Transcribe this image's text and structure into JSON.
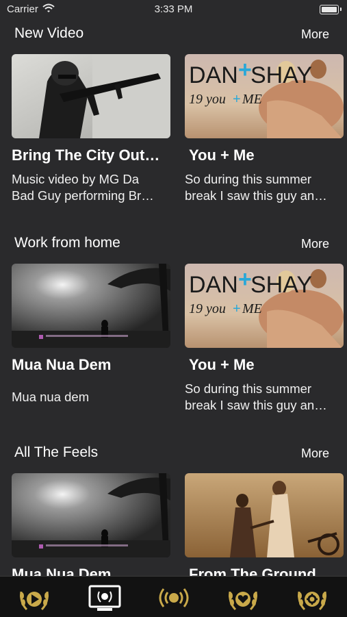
{
  "status_bar": {
    "carrier": "Carrier",
    "time": "3:33 PM"
  },
  "sections": [
    {
      "title": "New Video",
      "more": "More",
      "cards": [
        {
          "title": "Bring The City Out…",
          "desc_lines": [
            "Music video by MG Da",
            "Bad Guy performing Br…"
          ]
        },
        {
          "title": "You + Me",
          "desc_lines": [
            "So during this summer",
            "break I saw this guy an…"
          ],
          "thumb_text": {
            "brand_a": "DAN",
            "brand_b": "SHAY",
            "sub_a": "19 you",
            "sub_b": "ME"
          }
        }
      ]
    },
    {
      "title": "Work from home",
      "more": "More",
      "cards": [
        {
          "title": "Mua Nua Dem",
          "desc_lines": [
            "Mua nua dem"
          ]
        },
        {
          "title": "You + Me",
          "desc_lines": [
            "So during this summer",
            "break I saw this guy an…"
          ],
          "thumb_text": {
            "brand_a": "DAN",
            "brand_b": "SHAY",
            "sub_a": "19 you",
            "sub_b": "ME"
          }
        }
      ]
    },
    {
      "title": "All The Feels",
      "more": "More",
      "cards": [
        {
          "title": "Mua Nua Dem",
          "desc_lines": []
        },
        {
          "title": "From The Ground",
          "desc_lines": []
        }
      ]
    }
  ],
  "tab_bar": {
    "tabs": [
      {
        "icon": "laurel-play-icon"
      },
      {
        "icon": "tv-laurel-icon"
      },
      {
        "icon": "broadcast-icon"
      },
      {
        "icon": "laurel-heart-icon"
      },
      {
        "icon": "laurel-gear-icon"
      }
    ],
    "accent": "#c9a94a"
  }
}
